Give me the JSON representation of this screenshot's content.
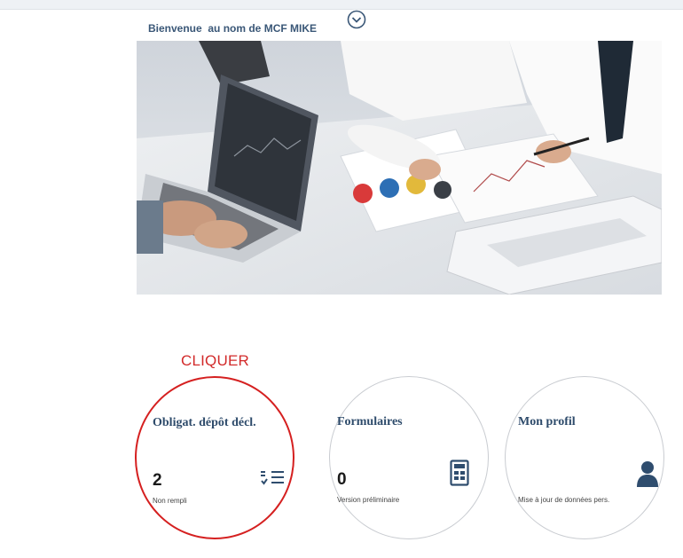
{
  "header": {
    "welcome_text": "Bienvenue  au nom de MCF MIKE",
    "toggle_icon": "chevron-down-circle-icon"
  },
  "hero": {
    "image_subject": "office-meeting-laptops-charts"
  },
  "callout": {
    "label": "CLIQUER",
    "color": "#d22a2a"
  },
  "tiles": [
    {
      "title": "Obligat. dépôt décl.",
      "count": "2",
      "subtitle": "Non rempli",
      "icon": "checklist-icon",
      "highlighted": true
    },
    {
      "title": "Formulaires",
      "count": "0",
      "subtitle": "Version préliminaire",
      "icon": "form-document-icon"
    },
    {
      "title": "Mon profil",
      "count": "",
      "subtitle": "Mise à jour de données pers.",
      "icon": "user-profile-icon"
    }
  ],
  "colors": {
    "title": "#2e4b6b",
    "highlight": "#d52020",
    "icon": "#2f4d6e"
  }
}
